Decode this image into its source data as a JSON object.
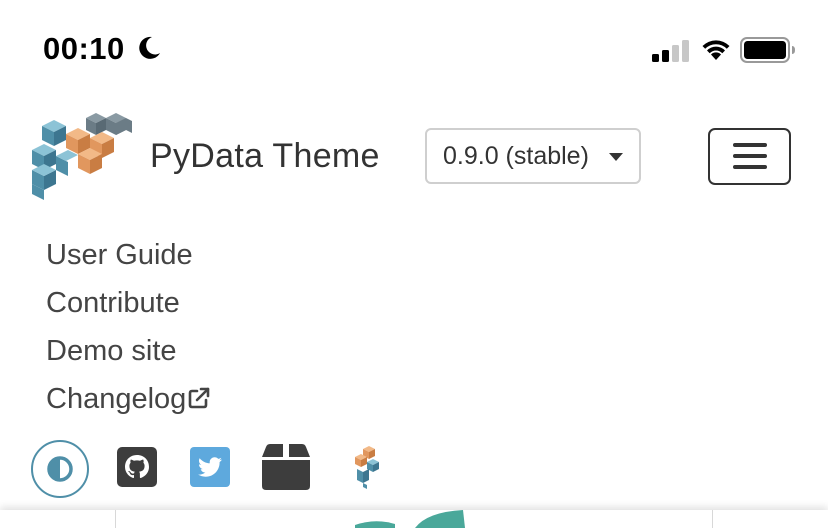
{
  "status_bar": {
    "time": "00:10"
  },
  "navbar": {
    "brand": "PyData Theme",
    "version": "0.9.0 (stable)"
  },
  "nav_links": [
    {
      "label": "User Guide"
    },
    {
      "label": "Contribute"
    },
    {
      "label": "Demo site"
    },
    {
      "label": "Changelog",
      "external": true
    }
  ],
  "icons": [
    "moon-icon",
    "signal-icon",
    "wifi-icon",
    "battery-icon",
    "pydata-logo",
    "caret-down-icon",
    "hamburger-icon",
    "external-link-icon",
    "theme-switch-icon",
    "github-icon",
    "twitter-icon",
    "package-icon",
    "pydata-small-logo"
  ],
  "colors": {
    "logo_blue": "#4f8fa8",
    "logo_orange": "#e1975e",
    "logo_gray": "#6b7c86",
    "twitter_blue": "#5ea9dd",
    "icon_dark": "#3d3d3d",
    "text": "#333333"
  }
}
